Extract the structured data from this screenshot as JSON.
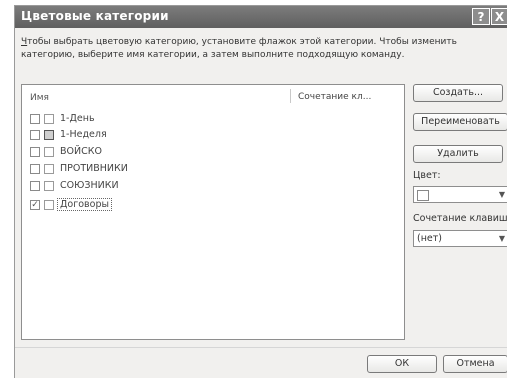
{
  "dialog": {
    "title": "Цветовые категории",
    "help_label": "?",
    "close_label": "X"
  },
  "instructions": {
    "line1_prefix": "Ч",
    "line1_rest": "тобы выбрать цветовую категорию, установите флажок этой категории. Чтобы изменить",
    "line2": "категорию, выберите имя категории, а затем выполните подходящую команду."
  },
  "list": {
    "column_name": "Имя",
    "column_shortcut": "Сочетание кл...",
    "items": [
      {
        "label": "1-День",
        "checked": false,
        "filled": false
      },
      {
        "label": "1-Неделя",
        "checked": false,
        "filled": true
      },
      {
        "label": "ВОЙСКО",
        "checked": false,
        "filled": false
      },
      {
        "label": "ПРОТИВНИКИ",
        "checked": false,
        "filled": false
      },
      {
        "label": "СОЮЗНИКИ",
        "checked": false,
        "filled": false
      },
      {
        "label": "Договоры",
        "checked": true,
        "filled": false,
        "selected": true
      }
    ]
  },
  "side": {
    "create_label": "Создать...",
    "rename_label": "Переименовать",
    "delete_label": "Удалить",
    "color_label": "Цвет:",
    "shortcut_label": "Сочетание клавиш",
    "shortcut_value": "(нет)"
  },
  "footer": {
    "ok_label": "ОК",
    "cancel_label": "Отмена"
  }
}
